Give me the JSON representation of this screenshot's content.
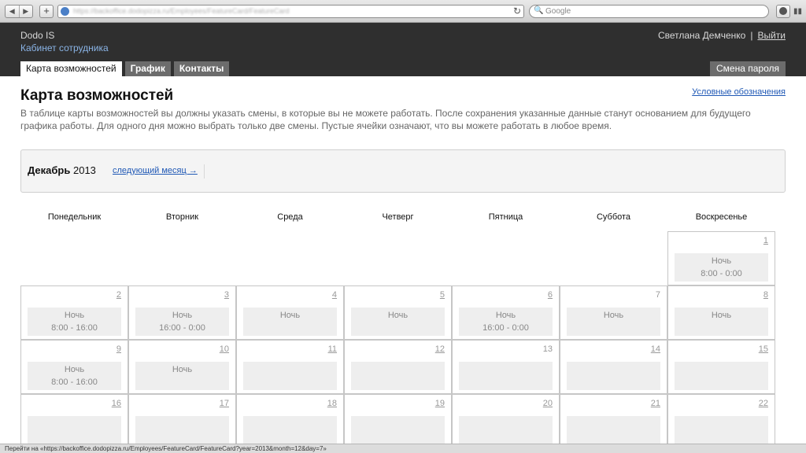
{
  "browser": {
    "url": "https://backoffice.dodopizza.ru/Employees/FeatureCard/FeatureCard",
    "search_placeholder": "Google",
    "status_text": "Перейти на «https://backoffice.dodopizza.ru/Employees/FeatureCard/FeatureCard?year=2013&month=12&day=7»"
  },
  "header": {
    "logo": "Dodo IS",
    "subtitle": "Кабинет сотрудника",
    "user_name": "Светлана Демченко",
    "separator": "|",
    "logout": "Выйти",
    "tabs": [
      {
        "label": "Карта возможностей"
      },
      {
        "label": "График"
      },
      {
        "label": "Контакты"
      }
    ],
    "change_password": "Смена пароля"
  },
  "page": {
    "title": "Карта возможностей",
    "legend_link": "Условные обозначения",
    "intro": "В таблице карты возможностей вы должны указать смены, в которые вы не можете работать. После сохранения указанные данные станут основанием для будущего графика работы. Для одного дня можно выбрать только две смены. Пустые ячейки означают, что вы можете работать в любое время.",
    "month": "Декабрь",
    "year": "2013",
    "next_month": "следующий месяц →"
  },
  "weekdays": [
    "Понедельник",
    "Вторник",
    "Среда",
    "Четверг",
    "Пятница",
    "Суббота",
    "Воскресенье"
  ],
  "calendar": {
    "first_weekday_index": 6,
    "days": [
      {
        "day": "1",
        "shift": "Ночь",
        "time": "8:00 - 0:00"
      },
      {
        "day": "2",
        "shift": "Ночь",
        "time": "8:00 - 16:00"
      },
      {
        "day": "3",
        "shift": "Ночь",
        "time": "16:00 - 0:00"
      },
      {
        "day": "4",
        "shift": "Ночь",
        "time": ""
      },
      {
        "day": "5",
        "shift": "Ночь",
        "time": ""
      },
      {
        "day": "6",
        "shift": "Ночь",
        "time": "16:00 - 0:00"
      },
      {
        "day": "7",
        "shift": "Ночь",
        "time": ""
      },
      {
        "day": "8",
        "shift": "Ночь",
        "time": ""
      },
      {
        "day": "9",
        "shift": "Ночь",
        "time": "8:00 - 16:00"
      },
      {
        "day": "10",
        "shift": "Ночь",
        "time": ""
      },
      {
        "day": "11",
        "shift": "",
        "time": ""
      },
      {
        "day": "12",
        "shift": "",
        "time": ""
      },
      {
        "day": "13",
        "shift": "",
        "time": ""
      },
      {
        "day": "14",
        "shift": "",
        "time": ""
      },
      {
        "day": "15",
        "shift": "",
        "time": ""
      },
      {
        "day": "16",
        "shift": "",
        "time": ""
      },
      {
        "day": "17",
        "shift": "",
        "time": ""
      },
      {
        "day": "18",
        "shift": "",
        "time": ""
      },
      {
        "day": "19",
        "shift": "",
        "time": ""
      },
      {
        "day": "20",
        "shift": "",
        "time": ""
      },
      {
        "day": "21",
        "shift": "",
        "time": ""
      },
      {
        "day": "22",
        "shift": "",
        "time": ""
      }
    ]
  }
}
